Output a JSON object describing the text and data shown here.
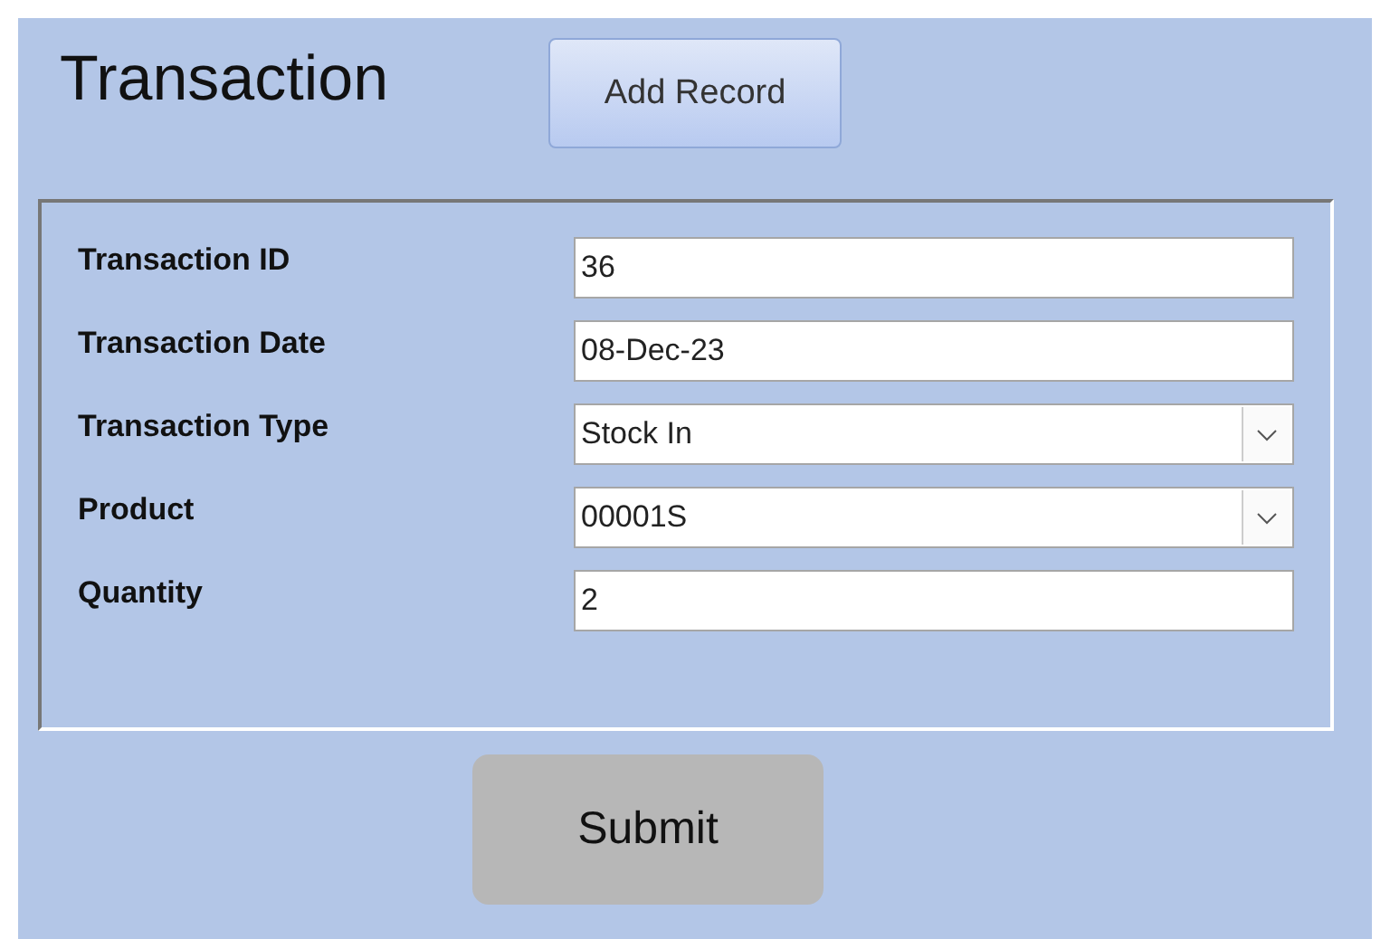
{
  "form": {
    "title": "Transaction",
    "add_button": "Add Record",
    "fields": [
      {
        "label": "Transaction ID",
        "value": "36",
        "kind": "text"
      },
      {
        "label": "Transaction Date",
        "value": "08-Dec-23",
        "kind": "text"
      },
      {
        "label": "Transaction Type",
        "value": "Stock In",
        "kind": "combo"
      },
      {
        "label": "Product",
        "value": "00001S",
        "kind": "combo"
      },
      {
        "label": "Quantity",
        "value": "2",
        "kind": "text"
      }
    ],
    "submit_button": "Submit"
  }
}
